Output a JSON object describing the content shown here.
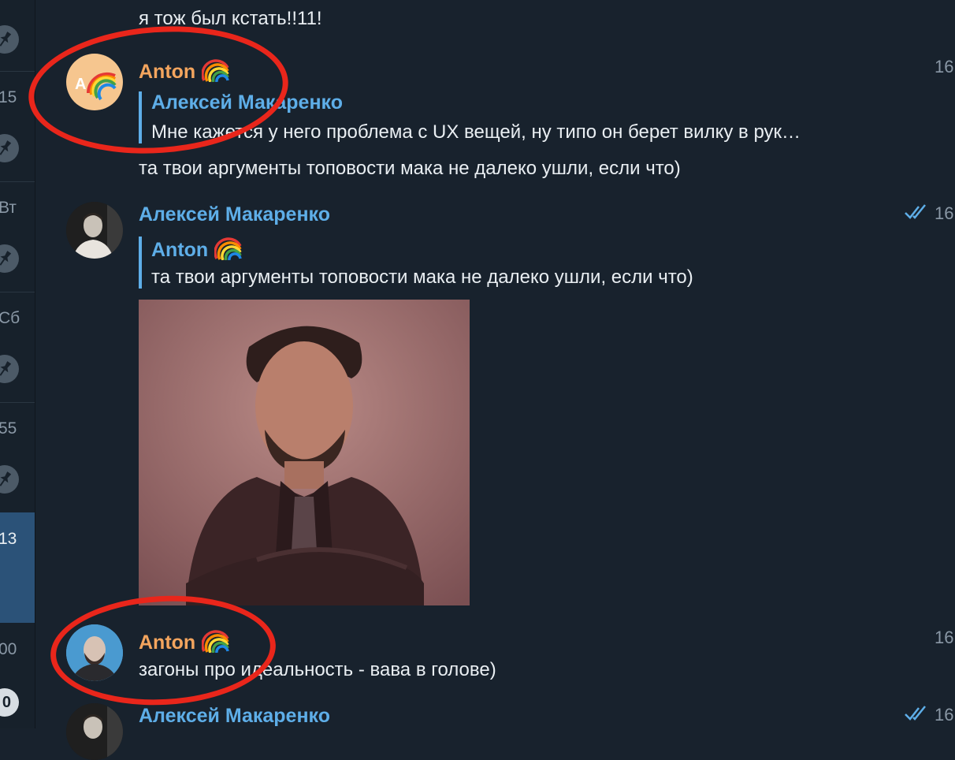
{
  "sidebar": {
    "times": [
      "15",
      "Вт",
      "Сб",
      "55",
      "13",
      "00"
    ],
    "badge": "0"
  },
  "messages": {
    "top_text": "я тож был кстать!!11!",
    "m1": {
      "sender": "Anton",
      "avatar_initial": "A",
      "time": "16",
      "reply_name": "Алексей Макаренко",
      "reply_text": "Мне кажется у него проблема с UX вещей, ну типо он берет вилку в рук…",
      "text": "та твои аргументы топовости мака не далеко ушли, если что)"
    },
    "m2": {
      "sender": "Алексей Макаренко",
      "time": "16",
      "reply_name": "Anton",
      "reply_text": "та твои аргументы топовости мака не далеко ушли, если что)"
    },
    "m3": {
      "sender": "Anton",
      "time": "16",
      "text": "загоны про идеальность - вава в голове)"
    },
    "m4": {
      "sender": "Алексей Макаренко",
      "time": "16"
    }
  },
  "colors": {
    "background": "#18222d",
    "sender_orange": "#f3a55e",
    "sender_blue": "#5eaee8",
    "annotation_red": "#e9261b"
  },
  "icons": [
    "pin-icon",
    "rainbow-emoji-icon",
    "double-check-icon"
  ]
}
